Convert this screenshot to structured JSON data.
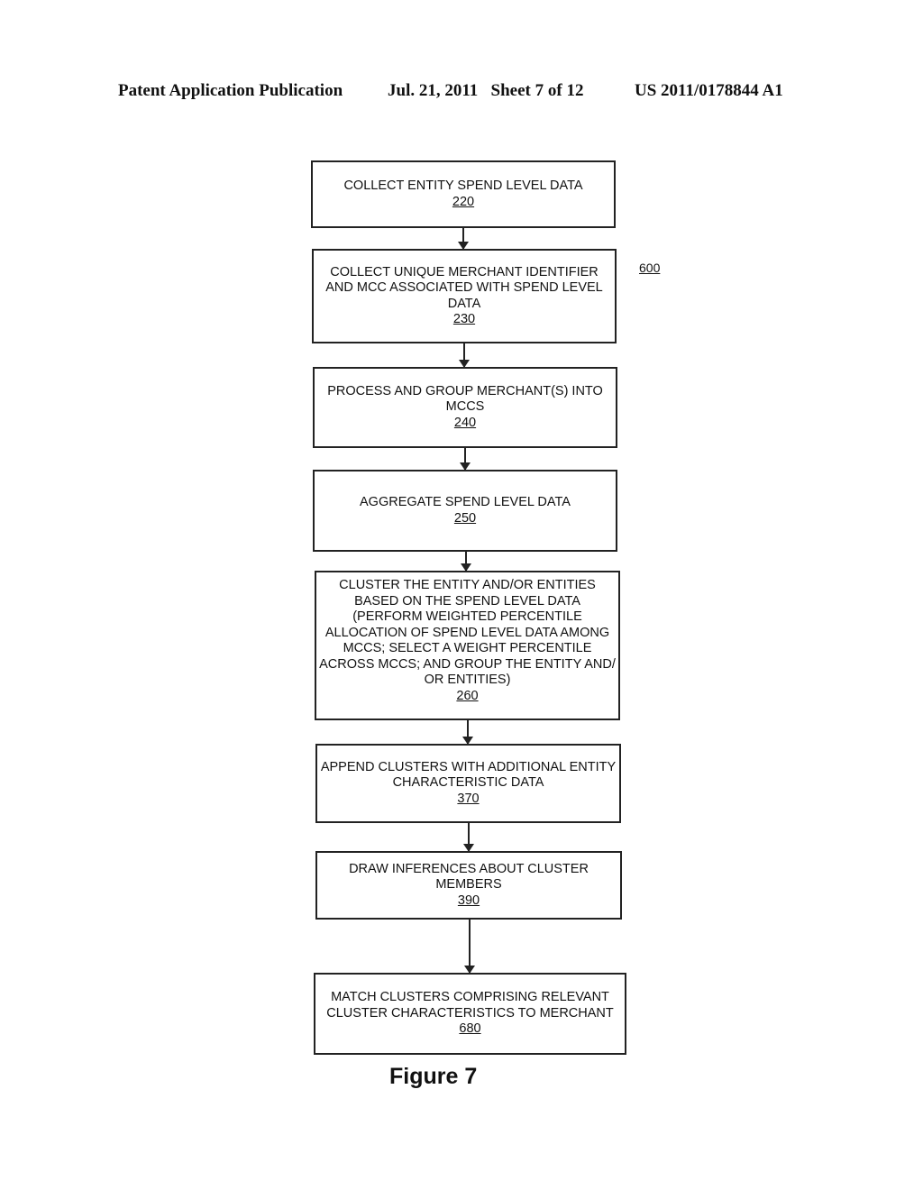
{
  "header": {
    "publication": "Patent Application Publication",
    "date_sheet": "Jul. 21, 2011   Sheet 7 of 12",
    "number": "US 2011/0178844 A1"
  },
  "diagram": {
    "ref_label": "600",
    "figure_caption": "Figure 7",
    "steps": [
      {
        "text": "COLLECT ENTITY SPEND LEVEL DATA",
        "ref": "220"
      },
      {
        "text": "COLLECT UNIQUE MERCHANT IDENTIFIER AND MCC ASSOCIATED WITH SPEND LEVEL DATA",
        "ref": "230"
      },
      {
        "text": "PROCESS AND GROUP MERCHANT(S) INTO MCCS",
        "ref": "240"
      },
      {
        "text": "AGGREGATE SPEND LEVEL DATA",
        "ref": "250"
      },
      {
        "text": "CLUSTER THE ENTITY AND/OR ENTITIES BASED ON THE SPEND LEVEL DATA (PERFORM WEIGHTED PERCENTILE ALLOCATION OF SPEND LEVEL DATA AMONG MCCS; SELECT A WEIGHT PERCENTILE ACROSS MCCS; AND GROUP THE ENTITY AND/ OR ENTITIES)",
        "ref": "260"
      },
      {
        "text": "APPEND CLUSTERS WITH ADDITIONAL ENTITY CHARACTERISTIC DATA",
        "ref": "370"
      },
      {
        "text": "DRAW INFERENCES ABOUT CLUSTER MEMBERS",
        "ref": "390"
      },
      {
        "text": "MATCH CLUSTERS COMPRISING RELEVANT CLUSTER CHARACTERISTICS TO MERCHANT",
        "ref": "680"
      }
    ]
  }
}
